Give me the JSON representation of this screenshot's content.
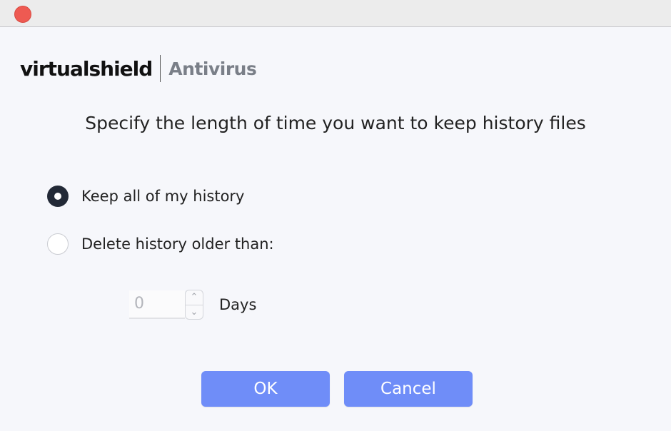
{
  "window": {
    "close_icon": "close-dot-icon",
    "accent_color": "#6f8df8",
    "close_color": "#ee5a52"
  },
  "logo": {
    "brand": "virtualshield",
    "product": "Antivirus"
  },
  "dialog": {
    "heading": "Specify the length of time you want to keep history files",
    "options": [
      {
        "label": "Keep all of my history",
        "selected": true
      },
      {
        "label": "Delete history older than:",
        "selected": false
      }
    ],
    "days_value": "0",
    "days_label": "Days",
    "up_icon": "chevron-up-icon",
    "down_icon": "chevron-down-icon"
  },
  "buttons": {
    "ok": "OK",
    "cancel": "Cancel"
  }
}
